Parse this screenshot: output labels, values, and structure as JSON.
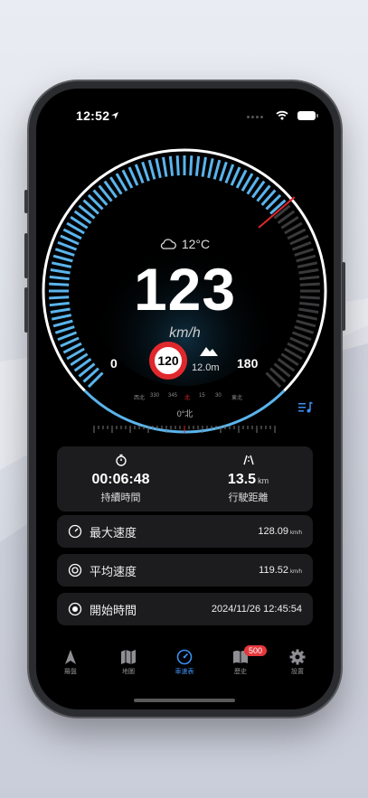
{
  "status_bar": {
    "time": "12:52"
  },
  "gauge": {
    "temperature": "12°C",
    "speed": "123",
    "unit": "km/h",
    "min": "0",
    "max": "180",
    "speed_limit": "120",
    "altitude": "12.0m",
    "heading": "0°北",
    "compass_ticks": [
      "西北",
      "330",
      "345",
      "北",
      "15",
      "30",
      "東北"
    ]
  },
  "stats": {
    "duration_value": "00:06:48",
    "duration_label": "持續時間",
    "distance_value": "13.5",
    "distance_unit": "km",
    "distance_label": "行駛距離"
  },
  "rows": [
    {
      "label": "最大速度",
      "value": "128.09",
      "unit": "km/h"
    },
    {
      "label": "平均速度",
      "value": "119.52",
      "unit": "km/h"
    },
    {
      "label": "開始時間",
      "value": "2024/11/26 12:45:54"
    }
  ],
  "tabs": [
    {
      "label": "羅盤",
      "icon": "compass-icon"
    },
    {
      "label": "地圖",
      "icon": "map-icon"
    },
    {
      "label": "車速表",
      "icon": "speedometer-icon",
      "active": true
    },
    {
      "label": "歷史",
      "icon": "book-icon",
      "badge": "500"
    },
    {
      "label": "設置",
      "icon": "gear-icon"
    }
  ],
  "colors": {
    "accent": "#3a8ff0",
    "gauge_blue": "#5ab4ec",
    "limit_red": "#e0282c",
    "badge_red": "#e5383b"
  }
}
